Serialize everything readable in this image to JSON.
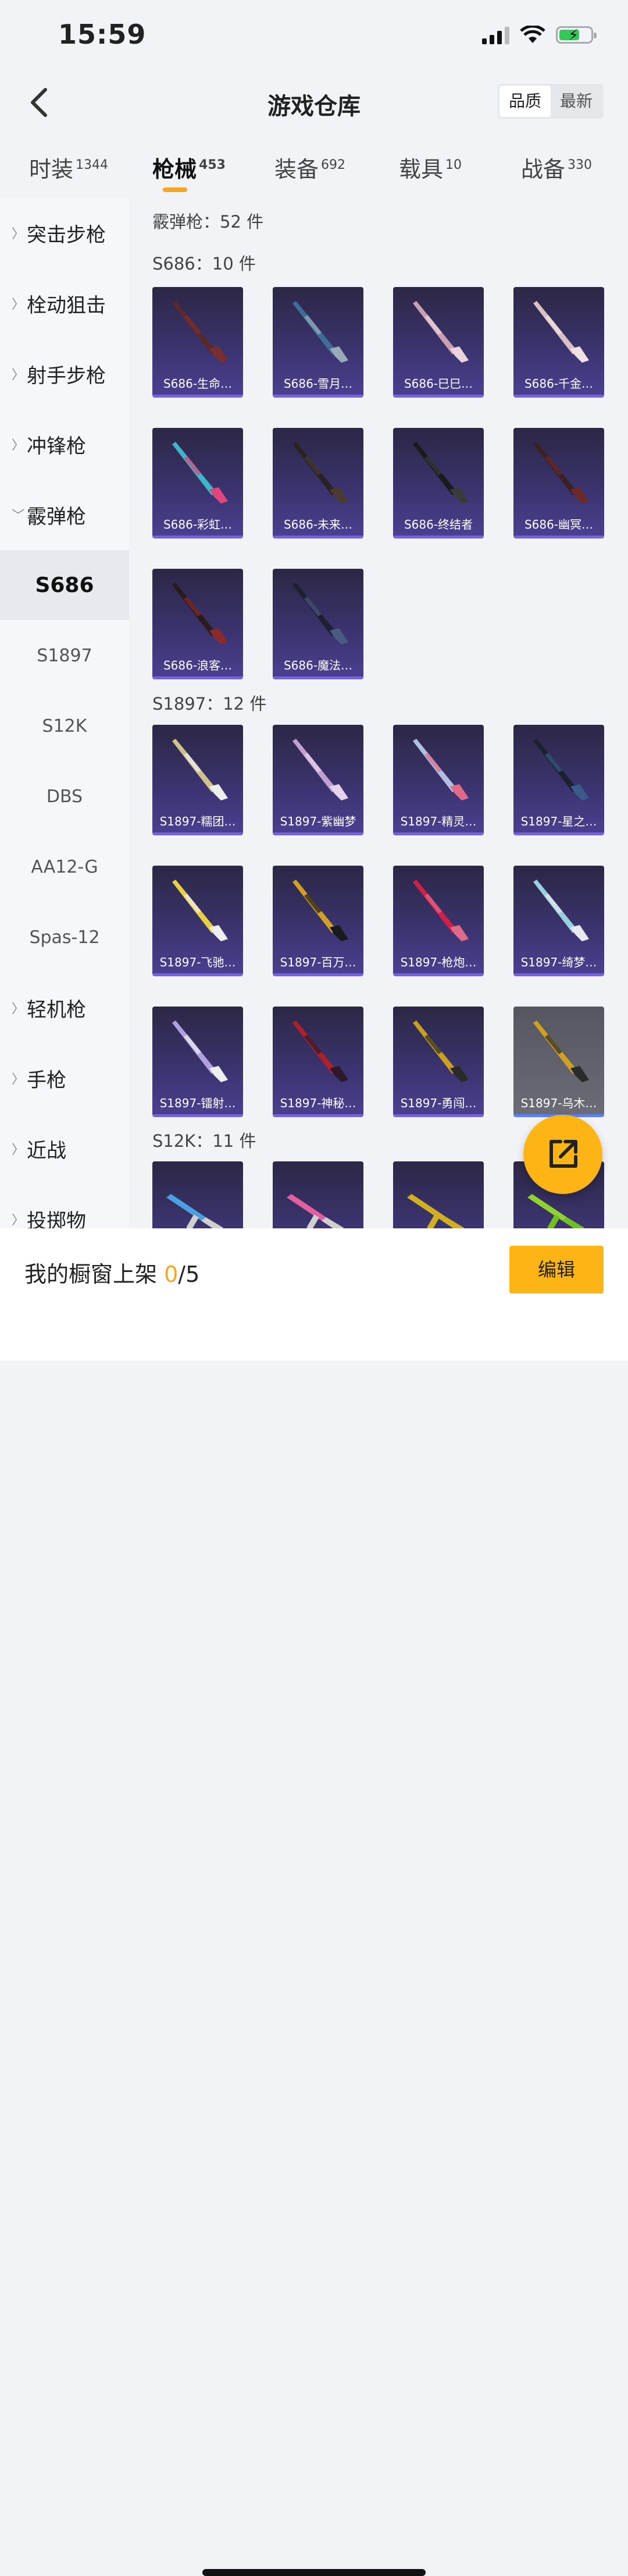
{
  "status": {
    "time": "15:59"
  },
  "header": {
    "title": "游戏仓库",
    "sort_quality": "品质",
    "sort_newest": "最新"
  },
  "categories": [
    {
      "label": "时装",
      "count": "1344"
    },
    {
      "label": "枪械",
      "count": "453"
    },
    {
      "label": "装备",
      "count": "692"
    },
    {
      "label": "载具",
      "count": "10"
    },
    {
      "label": "战备",
      "count": "330"
    }
  ],
  "sidebar": {
    "groups": [
      "突击步枪",
      "栓动狙击",
      "射手步枪",
      "冲锋枪",
      "霰弹枪",
      "轻机枪",
      "手枪",
      "近战",
      "投掷物"
    ],
    "subs": [
      "S686",
      "S1897",
      "S12K",
      "DBS",
      "AA12-G",
      "Spas-12"
    ]
  },
  "content": {
    "total": "霰弹枪：52 件",
    "sections": [
      {
        "title": "S686：10 件",
        "items": [
          "S686-生命…",
          "S686-雪月…",
          "S686-巳巳…",
          "S686-千金…",
          "S686-彩虹…",
          "S686-未来…",
          "S686-终结者",
          "S686-幽冥…",
          "S686-浪客…",
          "S686-魔法…"
        ]
      },
      {
        "title": "S1897：12 件",
        "items": [
          "S1897-糯团…",
          "S1897-紫幽梦",
          "S1897-精灵…",
          "S1897-星之…",
          "S1897-飞驰…",
          "S1897-百万…",
          "S1897-枪炮…",
          "S1897-绮梦…",
          "S1897-镭射…",
          "S1897-神秘…",
          "S1897-勇闯…",
          "S1897-乌木…"
        ]
      },
      {
        "title": "S12K：11 件",
        "items": [
          "",
          "",
          "",
          ""
        ]
      }
    ]
  },
  "bottom": {
    "label": "我的橱窗上架",
    "count": "0",
    "max": "/5",
    "edit": "编辑"
  }
}
